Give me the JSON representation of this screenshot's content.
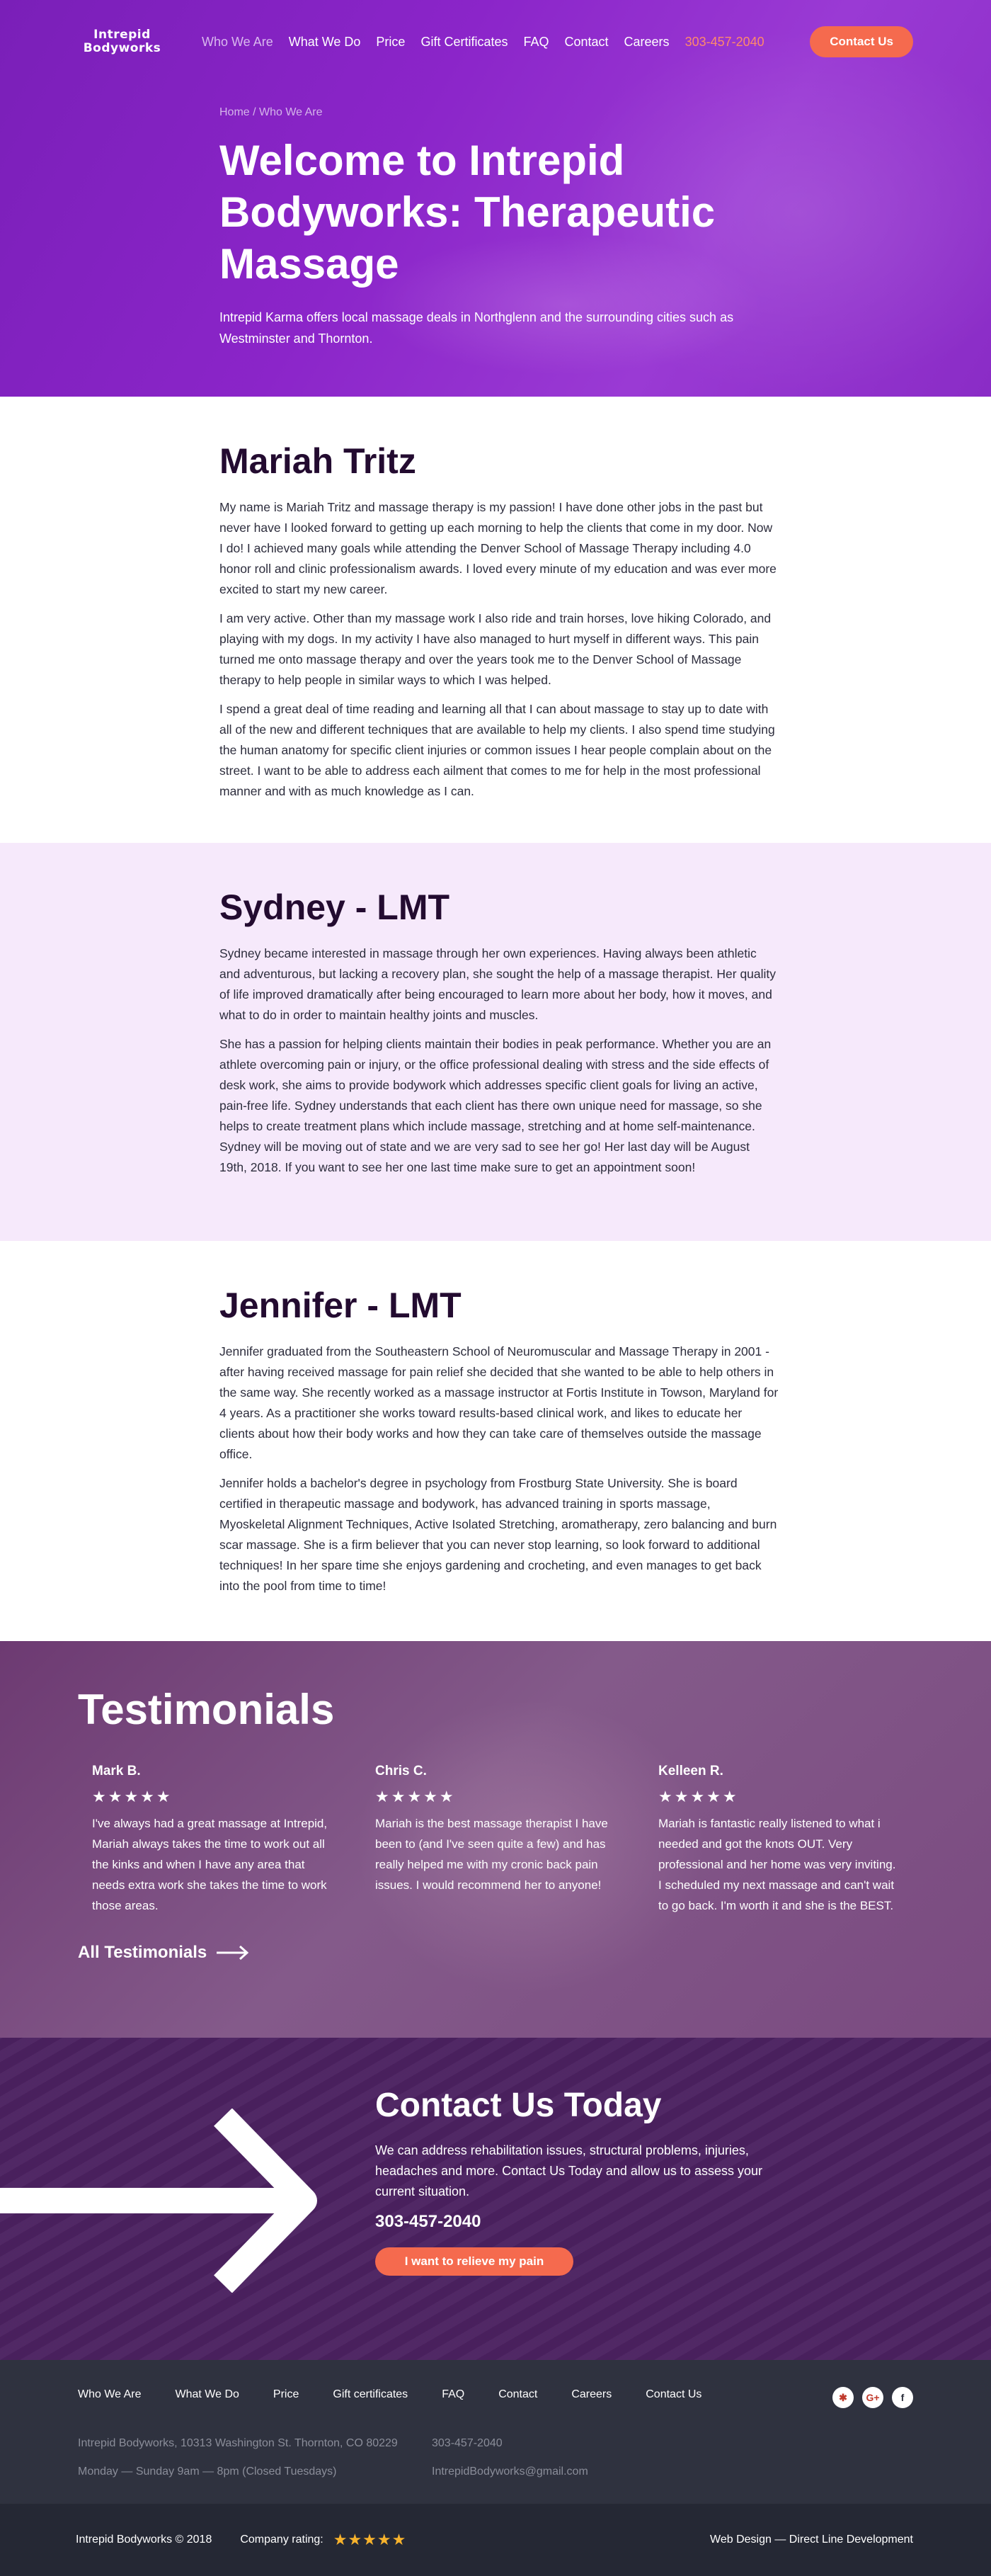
{
  "nav": {
    "logo_line1": "Intrepid",
    "logo_line2": "Bodyworks",
    "links": [
      "Who We Are",
      "What We Do",
      "Price",
      "Gift Certificates",
      "FAQ",
      "Contact",
      "Careers"
    ],
    "phone": "303-457-2040",
    "contact_button": "Contact Us"
  },
  "hero": {
    "breadcrumb": "Home / Who We Are",
    "title": "Welcome to Intrepid Bodyworks: Therapeutic Massage",
    "subtitle": "Intrepid Karma offers local massage deals in Northglenn and the surrounding cities such as Westminster and Thornton."
  },
  "bios": [
    {
      "name": "Mariah Tritz",
      "paragraphs": [
        "My name is Mariah Tritz and massage therapy is my passion!  I have done other jobs in the past but never have I looked forward to getting up each morning to help the clients that come in my door.  Now I do!  I achieved many goals while attending the Denver School of Massage Therapy including 4.0 honor roll and clinic professionalism awards.  I loved every minute of my education and was ever more excited to start my new career.",
        "I am very active.  Other than my massage work I also ride and train horses, love hiking Colorado, and playing with my dogs.  In my activity I have also managed to hurt myself in different ways.  This pain turned me onto massage therapy and over the years took me to the Denver School of Massage therapy to help people in similar ways to which I was helped.",
        "I spend a  great deal of time reading and learning all that I can about massage to stay up to date with all of the new and different techniques that are available to help my clients.  I also spend time studying the human anatomy for specific client injuries or common issues I hear people complain about on the street.  I want to be able to address each ailment that comes to me for help in the most professional manner and with as much knowledge as I can."
      ]
    },
    {
      "name": "Sydney - LMT",
      "paragraphs": [
        "Sydney became interested in massage through her own experiences. Having always been athletic and adventurous, but lacking a recovery plan, she sought the help of a massage therapist. Her quality of life improved dramatically after being encouraged to learn more about her body, how it moves, and what to do in order to maintain healthy joints and muscles.",
        "She has a passion for helping clients maintain their bodies in peak performance. Whether you are an athlete overcoming pain or injury, or the office professional dealing with stress and the side effects of desk work, she aims to provide bodywork which addresses specific client goals for living an active, pain-free life. Sydney understands that each client has there own unique need for massage, so she helps to create treatment plans which include massage, stretching and at home self-maintenance. Sydney will be moving out of state and we are very sad to see her go! Her last day will be August 19th, 2018.  If you want to see her one last time make sure to get an appointment soon!"
      ]
    },
    {
      "name": "Jennifer - LMT",
      "paragraphs": [
        "Jennifer graduated from the Southeastern School of Neuromuscular and Massage Therapy in 2001 - after having received massage for pain relief she decided that she wanted to be able to help others in the same way. She recently worked as a massage instructor at Fortis Institute in Towson, Maryland for 4 years. As a practitioner she works toward results-based clinical work, and likes to educate her clients about how their body works and how they can take care of themselves outside the massage office.",
        "Jennifer holds a bachelor's degree in psychology from Frostburg State University. She is board certified in therapeutic massage and bodywork, has advanced training in sports massage, Myoskeletal Alignment Techniques, Active Isolated Stretching, aromatherapy, zero balancing and burn scar massage.  She is a firm believer that you can never stop learning, so look forward to additional techniques! In her spare time she enjoys gardening and crocheting, and even manages to get back into the pool from time to time!"
      ]
    }
  ],
  "testimonials": {
    "title": "Testimonials",
    "items": [
      {
        "name": "Mark B.",
        "stars": "★★★★★",
        "text": "I've always had a great massage at Intrepid, Mariah always takes the time to work out all the kinks and when I have any area that needs extra work she takes the time to work those areas."
      },
      {
        "name": "Chris C.",
        "stars": "★★★★★",
        "text": "Mariah is the best massage therapist I have been to (and I've seen quite a few) and has really helped me with my cronic back pain issues.  I would recommend her to anyone!"
      },
      {
        "name": "Kelleen R.",
        "stars": "★★★★★",
        "text": "Mariah is fantastic really listened to what i needed and got the knots OUT.  Very professional and her home was very inviting.  I scheduled my next massage and can't wait to go back.  I'm worth it and she is the BEST."
      }
    ],
    "all_link": "All Testimonials"
  },
  "cta": {
    "title": "Contact Us Today",
    "text": "We can address rehabilitation issues, structural problems, injuries, headaches and more. Contact Us Today and allow us to assess your current situation.",
    "phone": "303-457-2040",
    "button": "I want to relieve my pain"
  },
  "footer": {
    "links": [
      "Who We Are",
      "What We Do",
      "Price",
      "Gift certificates",
      "FAQ",
      "Contact",
      "Careers",
      "Contact Us"
    ],
    "address": "Intrepid Bodyworks, 10313 Washington St. Thornton, CO 80229",
    "hours": "Monday — Sunday 9am — 8pm (Closed Tuesdays)",
    "phone": "303-457-2040",
    "email": "IntrepidBodyworks@gmail.com",
    "social": [
      "yelp-icon",
      "google-plus-icon",
      "facebook-icon"
    ],
    "copyright": "Intrepid Bodyworks © 2018",
    "rating_label": "Company rating:",
    "rating_stars": "★★★★★",
    "credit": "Web Design — Direct Line Development"
  },
  "colors": {
    "hero_purple": "#8b25c9",
    "accent_orange": "#f56a4e",
    "bio_pink": "#f6e9fb",
    "cta_purple": "#4b2160",
    "footer_dark": "#2f323f"
  }
}
